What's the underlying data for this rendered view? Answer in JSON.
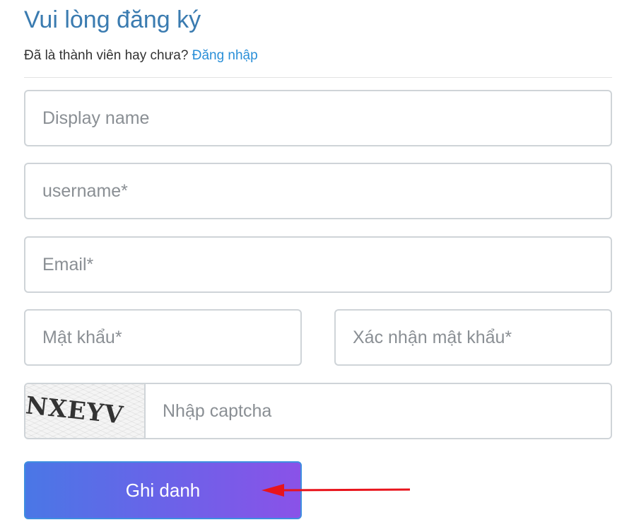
{
  "header": {
    "title": "Vui lòng đăng ký",
    "subtitle_text": "Đã là thành viên hay chưa?",
    "login_link": "Đăng nhập"
  },
  "form": {
    "display_name_placeholder": "Display name",
    "username_placeholder": "username*",
    "email_placeholder": "Email*",
    "password_placeholder": "Mật khẩu*",
    "confirm_password_placeholder": "Xác nhận mật khẩu*",
    "captcha_text": "NXEYV",
    "captcha_placeholder": "Nhập captcha",
    "submit_label": "Ghi danh"
  },
  "colors": {
    "title": "#3a7bb0",
    "link": "#2a8fd8",
    "button_gradient_start": "#4a77e6",
    "button_gradient_end": "#8a52e8",
    "annotation_arrow": "#e8141c"
  },
  "annotations": {
    "arrow_icon": "red-arrow-pointing-left"
  }
}
